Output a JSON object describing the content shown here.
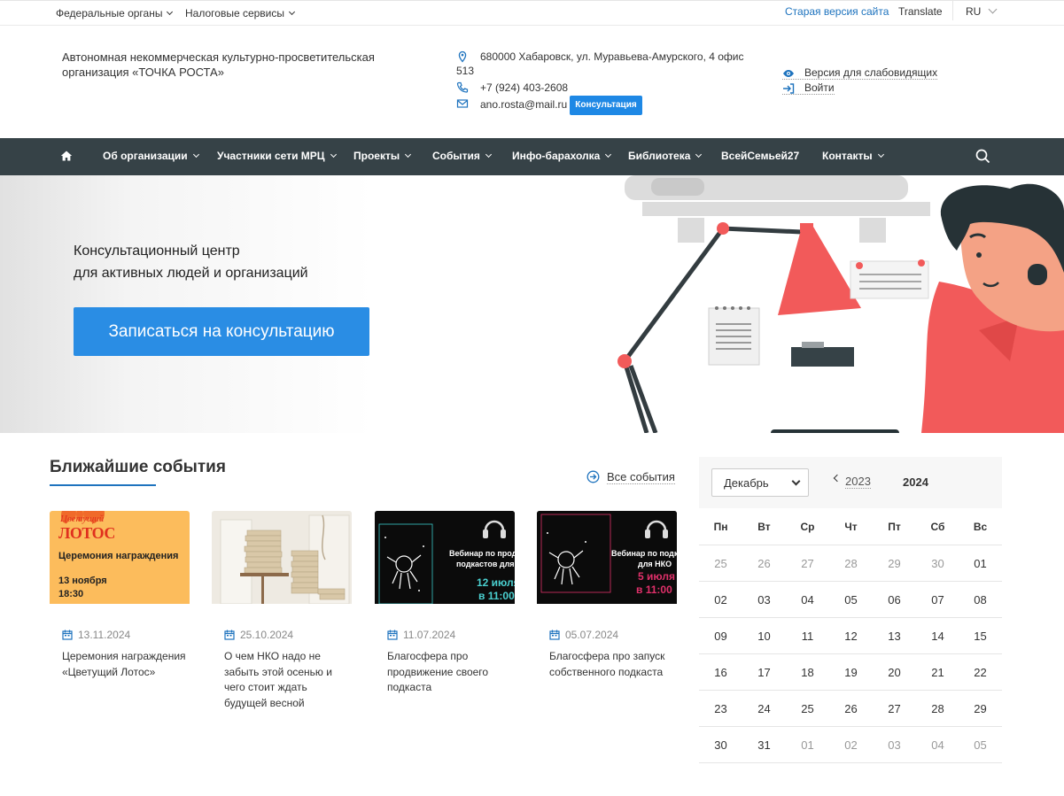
{
  "topbar": {
    "federal": "Федеральные органы",
    "tax": "Налоговые сервисы",
    "old_version": "Старая версия сайта",
    "translate": "Translate",
    "lang": "RU"
  },
  "header": {
    "org_name": "Автономная некоммерческая культурно-просветительская организация «ТОЧКА РОСТА»",
    "address_line1": "680000 Хабаровск, ул. Муравьева-Амурского, 4 офис",
    "address_line2": "513",
    "phone": "+7 (924) 403-2608",
    "email": "ano.rosta@mail.ru",
    "consult_label": "Консультация",
    "low_vision": "Версия для слабовидящих",
    "login": "Войти"
  },
  "nav": {
    "items": [
      {
        "label": "Об организации"
      },
      {
        "label": "Участники сети МРЦ"
      },
      {
        "label": "Проекты"
      },
      {
        "label": "События"
      },
      {
        "label": "Инфо-барахолка"
      },
      {
        "label": "Библиотека"
      },
      {
        "label": "ВсейСемьей27"
      },
      {
        "label": "Контакты"
      }
    ]
  },
  "hero": {
    "line1": "Консультационный центр",
    "line2": "для активных людей и организаций",
    "cta": "Записаться на консультацию"
  },
  "events": {
    "title": "Ближайшие события",
    "all_label": "Все события",
    "cards": [
      {
        "date": "13.11.2024",
        "title": "Церемония награждения «Цветущий Лотос»",
        "img_brand": "Цветущий",
        "img_brand2": "ЛОТОС",
        "img_caption": "Церемония награждения",
        "img_date": "13 ноября",
        "img_time": "18:30"
      },
      {
        "date": "25.10.2024",
        "title": "О чем НКО надо не забыть этой осенью и чего стоит ждать будущей весной"
      },
      {
        "date": "11.07.2024",
        "title": "Благосфера про продвижение своего подкаста",
        "img_text1": "Вебинар по продви",
        "img_text2": "подкастов для",
        "img_date": "12 июля",
        "img_time": "в 11:00"
      },
      {
        "date": "05.07.2024",
        "title": "Благосфера про запуск собственного подкаста",
        "img_text1": "Вебинар по подка",
        "img_text2": "для НКО",
        "img_date": "5 июля",
        "img_time": "в 11:00"
      }
    ]
  },
  "calendar": {
    "month": "Декабрь",
    "prev_year": "2023",
    "current_year": "2024",
    "weekdays": [
      "Пн",
      "Вт",
      "Ср",
      "Чт",
      "Пт",
      "Сб",
      "Вс"
    ],
    "weeks": [
      [
        {
          "d": "25",
          "dim": true
        },
        {
          "d": "26",
          "dim": true
        },
        {
          "d": "27",
          "dim": true
        },
        {
          "d": "28",
          "dim": true
        },
        {
          "d": "29",
          "dim": true
        },
        {
          "d": "30",
          "dim": true
        },
        {
          "d": "01"
        }
      ],
      [
        {
          "d": "02"
        },
        {
          "d": "03"
        },
        {
          "d": "04"
        },
        {
          "d": "05"
        },
        {
          "d": "06"
        },
        {
          "d": "07"
        },
        {
          "d": "08"
        }
      ],
      [
        {
          "d": "09"
        },
        {
          "d": "10"
        },
        {
          "d": "11"
        },
        {
          "d": "12"
        },
        {
          "d": "13"
        },
        {
          "d": "14"
        },
        {
          "d": "15"
        }
      ],
      [
        {
          "d": "16"
        },
        {
          "d": "17"
        },
        {
          "d": "18"
        },
        {
          "d": "19"
        },
        {
          "d": "20"
        },
        {
          "d": "21"
        },
        {
          "d": "22"
        }
      ],
      [
        {
          "d": "23"
        },
        {
          "d": "24"
        },
        {
          "d": "25"
        },
        {
          "d": "26"
        },
        {
          "d": "27"
        },
        {
          "d": "28"
        },
        {
          "d": "29"
        }
      ],
      [
        {
          "d": "30"
        },
        {
          "d": "31"
        },
        {
          "d": "01",
          "dim": true
        },
        {
          "d": "02",
          "dim": true
        },
        {
          "d": "03",
          "dim": true
        },
        {
          "d": "04",
          "dim": true
        },
        {
          "d": "05",
          "dim": true
        }
      ]
    ]
  },
  "colors": {
    "nav_bg": "#364247",
    "accent": "#2a8de4",
    "link": "#1e73be"
  }
}
